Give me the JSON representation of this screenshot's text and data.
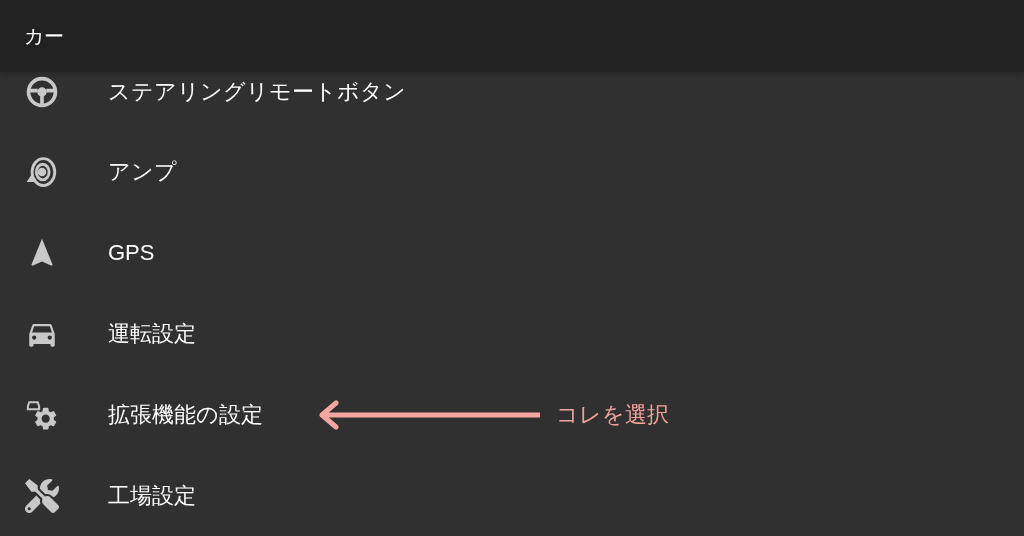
{
  "header": {
    "title": "カー"
  },
  "items": [
    {
      "label": "ステアリングリモートボタン"
    },
    {
      "label": "アンプ"
    },
    {
      "label": "GPS"
    },
    {
      "label": "運転設定"
    },
    {
      "label": "拡張機能の設定",
      "annotation": "コレを選択"
    },
    {
      "label": "工場設定"
    }
  ]
}
